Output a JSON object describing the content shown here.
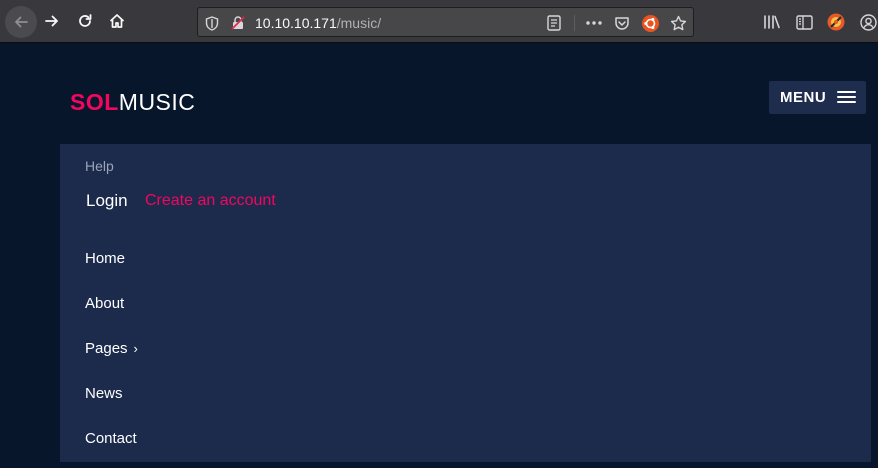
{
  "browser": {
    "url_host": "10.10.10.171",
    "url_path": "/music/",
    "icons": [
      "back-icon",
      "forward-icon",
      "reload-icon",
      "home-icon",
      "shield-icon",
      "insecure-lock-icon",
      "reader-view-icon",
      "more-actions-icon",
      "pocket-icon",
      "ubuntu-icon",
      "star-icon",
      "library-icon",
      "sidebar-icon",
      "extension-icon",
      "account-icon"
    ]
  },
  "site": {
    "logo_part1": "SOL",
    "logo_part2": "MUSIC",
    "menu_label": "MENU",
    "accent_color": "#f30660",
    "background_color": "#08162b",
    "panel_color": "#1c2a4c"
  },
  "menu_panel": {
    "help": "Help",
    "login": "Login",
    "create_account": "Create an account",
    "nav_items": [
      {
        "label": "Home"
      },
      {
        "label": "About"
      },
      {
        "label": "Pages",
        "chevron": "›"
      },
      {
        "label": "News"
      },
      {
        "label": "Contact"
      }
    ]
  }
}
